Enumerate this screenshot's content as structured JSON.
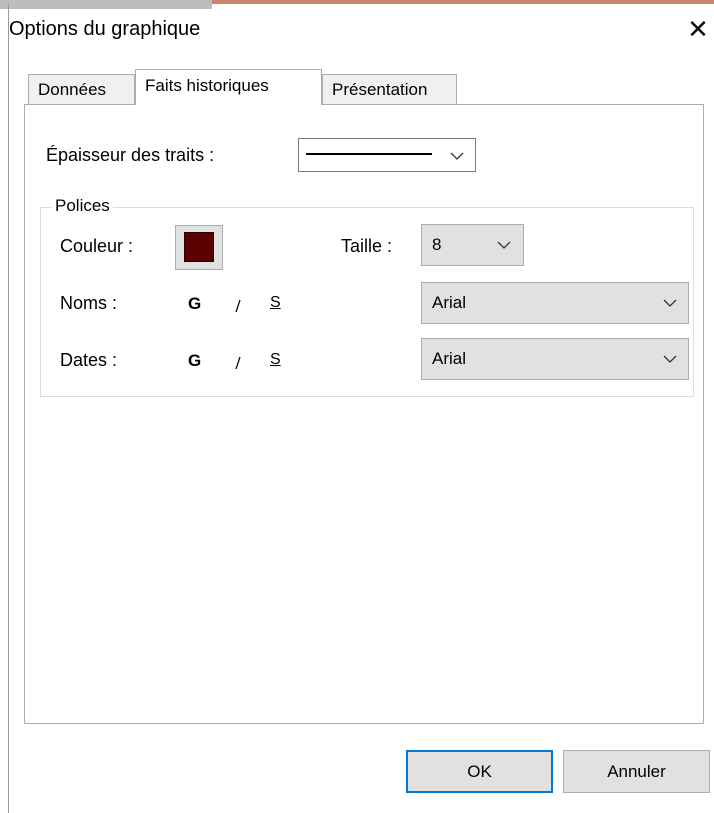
{
  "dialog": {
    "title": "Options du graphique",
    "close_glyph": "✕"
  },
  "tabs": [
    {
      "label": "Données",
      "active": false
    },
    {
      "label": "Faits historiques",
      "active": true
    },
    {
      "label": "Présentation",
      "active": false
    }
  ],
  "line_thickness": {
    "label": "Épaisseur des traits :"
  },
  "fonts_group": {
    "title": "Polices",
    "color_label": "Couleur :",
    "color_value": "#5a0000",
    "size_label": "Taille :",
    "size_value": "8",
    "noms": {
      "label": "Noms :",
      "bold": "G",
      "italic": "I",
      "underline": "S",
      "font": "Arial"
    },
    "dates": {
      "label": "Dates :",
      "bold": "G",
      "italic": "I",
      "underline": "S",
      "font": "Arial"
    }
  },
  "footer": {
    "ok_label": "OK",
    "cancel_label": "Annuler"
  },
  "icons": {
    "dropdown": "chevron-down-icon",
    "close": "close-icon"
  },
  "colors": {
    "accent": "#0078d7",
    "button_face": "#e1e1e1",
    "swatch": "#5a0000"
  }
}
